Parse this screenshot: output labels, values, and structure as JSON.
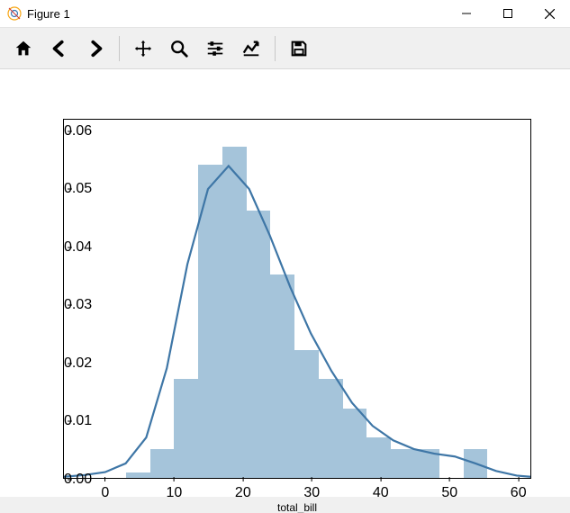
{
  "window": {
    "title": "Figure 1"
  },
  "toolbar": {
    "home": "home-icon",
    "back": "back-icon",
    "forward": "forward-icon",
    "pan": "pan-icon",
    "zoom": "zoom-icon",
    "subplots": "subplots-icon",
    "axes": "axes-icon",
    "save": "save-icon"
  },
  "chart_data": {
    "type": "histogram+kde",
    "xlabel": "total_bill",
    "ylabel": "",
    "xlim": [
      -6,
      62
    ],
    "ylim": [
      0,
      0.062
    ],
    "x_ticks": [
      0,
      10,
      20,
      30,
      40,
      50,
      60
    ],
    "y_ticks": [
      0.0,
      0.01,
      0.02,
      0.03,
      0.04,
      0.05,
      0.06
    ],
    "y_tick_labels": [
      "0.00",
      "0.01",
      "0.02",
      "0.03",
      "0.04",
      "0.05",
      "0.06"
    ],
    "hist": {
      "bin_width": 3.5,
      "bins": [
        {
          "start": 3.0,
          "density": 0.001
        },
        {
          "start": 6.5,
          "density": 0.005
        },
        {
          "start": 10.0,
          "density": 0.017
        },
        {
          "start": 13.5,
          "density": 0.054
        },
        {
          "start": 17.0,
          "density": 0.057
        },
        {
          "start": 20.5,
          "density": 0.046
        },
        {
          "start": 24.0,
          "density": 0.035
        },
        {
          "start": 27.5,
          "density": 0.022
        },
        {
          "start": 31.0,
          "density": 0.017
        },
        {
          "start": 34.5,
          "density": 0.012
        },
        {
          "start": 38.0,
          "density": 0.007
        },
        {
          "start": 41.5,
          "density": 0.005
        },
        {
          "start": 45.0,
          "density": 0.005
        },
        {
          "start": 48.5,
          "density": 0.0
        },
        {
          "start": 52.0,
          "density": 0.005
        }
      ]
    },
    "kde": {
      "x": [
        -6,
        -3,
        0,
        3,
        6,
        9,
        12,
        15,
        18,
        21,
        24,
        27,
        30,
        33,
        36,
        39,
        42,
        45,
        48,
        51,
        54,
        57,
        60,
        62
      ],
      "y": [
        0.0002,
        0.0005,
        0.001,
        0.0025,
        0.007,
        0.019,
        0.037,
        0.05,
        0.054,
        0.05,
        0.042,
        0.033,
        0.025,
        0.0185,
        0.013,
        0.009,
        0.0065,
        0.005,
        0.0042,
        0.0037,
        0.0025,
        0.0012,
        0.0004,
        0.0002
      ]
    }
  }
}
